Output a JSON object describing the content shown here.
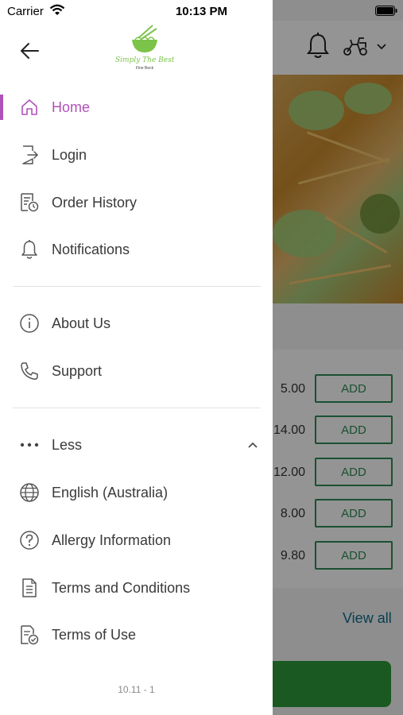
{
  "status_bar": {
    "carrier": "Carrier",
    "time": "10:13 PM"
  },
  "brand": {
    "title": "Simply The Best",
    "subtitle": "Fine Beck",
    "color": "#7cc34a"
  },
  "drawer": {
    "accent_color": "#b052b8",
    "primary_items": [
      {
        "label": "Home",
        "icon": "home-icon",
        "active": true
      },
      {
        "label": "Login",
        "icon": "login-icon"
      },
      {
        "label": "Order History",
        "icon": "order-history-icon"
      },
      {
        "label": "Notifications",
        "icon": "bell-icon"
      }
    ],
    "secondary_items": [
      {
        "label": "About Us",
        "icon": "info-icon"
      },
      {
        "label": "Support",
        "icon": "phone-icon"
      }
    ],
    "more_toggle": {
      "label": "Less",
      "icon": "more-dots-icon",
      "expanded": true
    },
    "extra_items": [
      {
        "label": "English (Australia)",
        "icon": "globe-icon"
      },
      {
        "label": "Allergy Information",
        "icon": "question-icon"
      },
      {
        "label": "Terms and Conditions",
        "icon": "document-icon"
      },
      {
        "label": "Terms of Use",
        "icon": "document-check-icon"
      }
    ],
    "version": "10.11 - 1"
  },
  "background": {
    "prices": [
      "5.00",
      "14.00",
      "12.00",
      "8.00",
      "9.80"
    ],
    "add_label": "ADD",
    "view_all": "View all",
    "accent_green": "#2e8b57"
  }
}
